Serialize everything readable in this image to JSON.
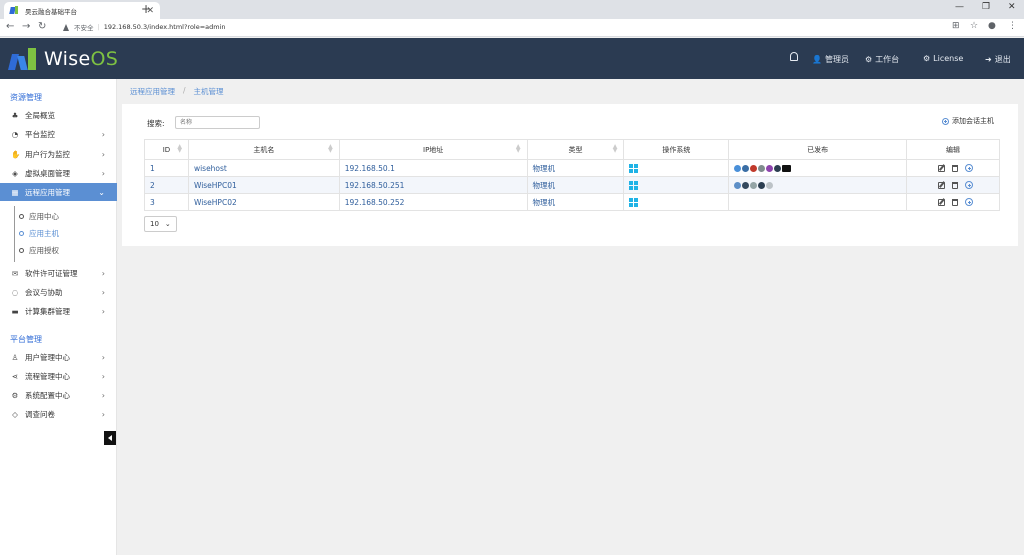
{
  "browser": {
    "tab_title": "昊云融合基础平台",
    "url_warning": "不安全",
    "url": "192.168.50.3/index.html?role=admin"
  },
  "header": {
    "logo_text_a": "Wise",
    "logo_text_b": "OS",
    "items": [
      {
        "icon": "user-icon",
        "label": "管理员"
      },
      {
        "icon": "gears-icon",
        "label": "工作台"
      },
      {
        "icon": "gears-icon",
        "label": "License"
      },
      {
        "icon": "logout-icon",
        "label": "退出"
      }
    ]
  },
  "sidebar": {
    "section1": "资源管理",
    "section2": "平台管理",
    "items1": [
      {
        "icon": "overview-icon",
        "label": "全局概览"
      },
      {
        "icon": "monitor-icon",
        "label": "平台监控"
      },
      {
        "icon": "thumb-icon",
        "label": "用户行为监控"
      },
      {
        "icon": "layers-icon",
        "label": "虚拟桌面管理"
      },
      {
        "icon": "grid-icon",
        "label": "远程应用管理"
      }
    ],
    "sub_items": [
      {
        "label": "应用中心"
      },
      {
        "label": "应用主机"
      },
      {
        "label": "应用授权"
      }
    ],
    "items2": [
      {
        "icon": "mail-icon",
        "label": "软件许可证管理"
      },
      {
        "icon": "chat-icon",
        "label": "会议与协助"
      },
      {
        "icon": "server-icon",
        "label": "计算集群管理"
      }
    ],
    "items3": [
      {
        "icon": "users-icon",
        "label": "用户管理中心"
      },
      {
        "icon": "share-icon",
        "label": "流程管理中心"
      },
      {
        "icon": "gear-icon",
        "label": "系统配置中心"
      },
      {
        "icon": "tag-icon",
        "label": "调查问卷"
      }
    ]
  },
  "breadcrumb": {
    "parent": "远程应用管理",
    "sep": "/",
    "current": "主机管理"
  },
  "toolbar": {
    "search_label": "搜索:",
    "search_placeholder": "名称",
    "add_label": "添加会话主机"
  },
  "table": {
    "headers": [
      "ID",
      "主机名",
      "IP地址",
      "类型",
      "操作系统",
      "已发布",
      "编辑"
    ],
    "rows": [
      {
        "id": "1",
        "name": "wisehost",
        "ip": "192.168.50.1",
        "type": "物理机"
      },
      {
        "id": "2",
        "name": "WiseHPC01",
        "ip": "192.168.50.251",
        "type": "物理机"
      },
      {
        "id": "3",
        "name": "WiseHPC02",
        "ip": "192.168.50.252",
        "type": "物理机"
      }
    ]
  },
  "pagination": {
    "page_size": "10"
  },
  "colors": {
    "header_bg": "#2b3b52",
    "accent": "#5b8fd3",
    "logo_green": "#7ec242"
  }
}
